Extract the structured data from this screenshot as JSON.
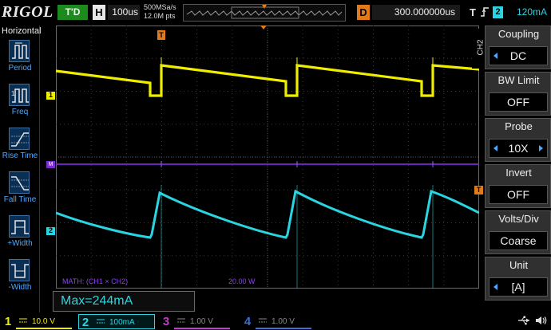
{
  "top": {
    "brand": "RIGOL",
    "run_status": "T'D",
    "timebase_key": "H",
    "timebase": "100us",
    "sample_rate": "500MSa/s",
    "memory_depth": "12.0M pts",
    "delay_key": "D",
    "horizontal_offset": "300.000000us",
    "trigger_key": "T",
    "trigger_source": "2",
    "trigger_level": "120mA"
  },
  "left_menu": {
    "title": "Horizontal",
    "items": [
      {
        "label": "Period",
        "icon": "period-icon"
      },
      {
        "label": "Freq",
        "icon": "freq-icon"
      },
      {
        "label": "Rise Time",
        "icon": "rise-time-icon"
      },
      {
        "label": "Fall Time",
        "icon": "fall-time-icon"
      },
      {
        "label": "+Width",
        "icon": "positive-width-icon"
      },
      {
        "label": "-Width",
        "icon": "negative-width-icon"
      }
    ]
  },
  "right_menu": {
    "channel_tab": "CH2",
    "items": [
      {
        "title": "Coupling",
        "value": "DC"
      },
      {
        "title": "BW Limit",
        "value": "OFF"
      },
      {
        "title": "Probe",
        "value": "10X"
      },
      {
        "title": "Invert",
        "value": "OFF"
      },
      {
        "title": "Volts/Div",
        "value": "Coarse"
      },
      {
        "title": "Unit",
        "value": "[A]"
      }
    ]
  },
  "markers": {
    "ch1": "1",
    "math": "M",
    "ch2": "2",
    "trigger_pos": "T",
    "trigger_level": "T"
  },
  "math": {
    "label": "MATH: (CH1 × CH2)",
    "scale": "20.00 W"
  },
  "measurement": "Max=244mA",
  "bottom": {
    "channels": [
      {
        "num": "1",
        "value": "10.0 V",
        "color": "#f0ee00"
      },
      {
        "num": "2",
        "value": "100mA",
        "color": "#2ad4e0"
      },
      {
        "num": "3",
        "value": "1.00 V",
        "color": "#c43ad0"
      },
      {
        "num": "4",
        "value": "1.00 V",
        "color": "#3a6ed8"
      }
    ]
  },
  "colors": {
    "ch1": "#f0ee00",
    "ch2": "#2ad4e0",
    "math": "#7a2bd1",
    "trigger": "#e07a1a",
    "menu_accent": "#4fa8ff"
  }
}
